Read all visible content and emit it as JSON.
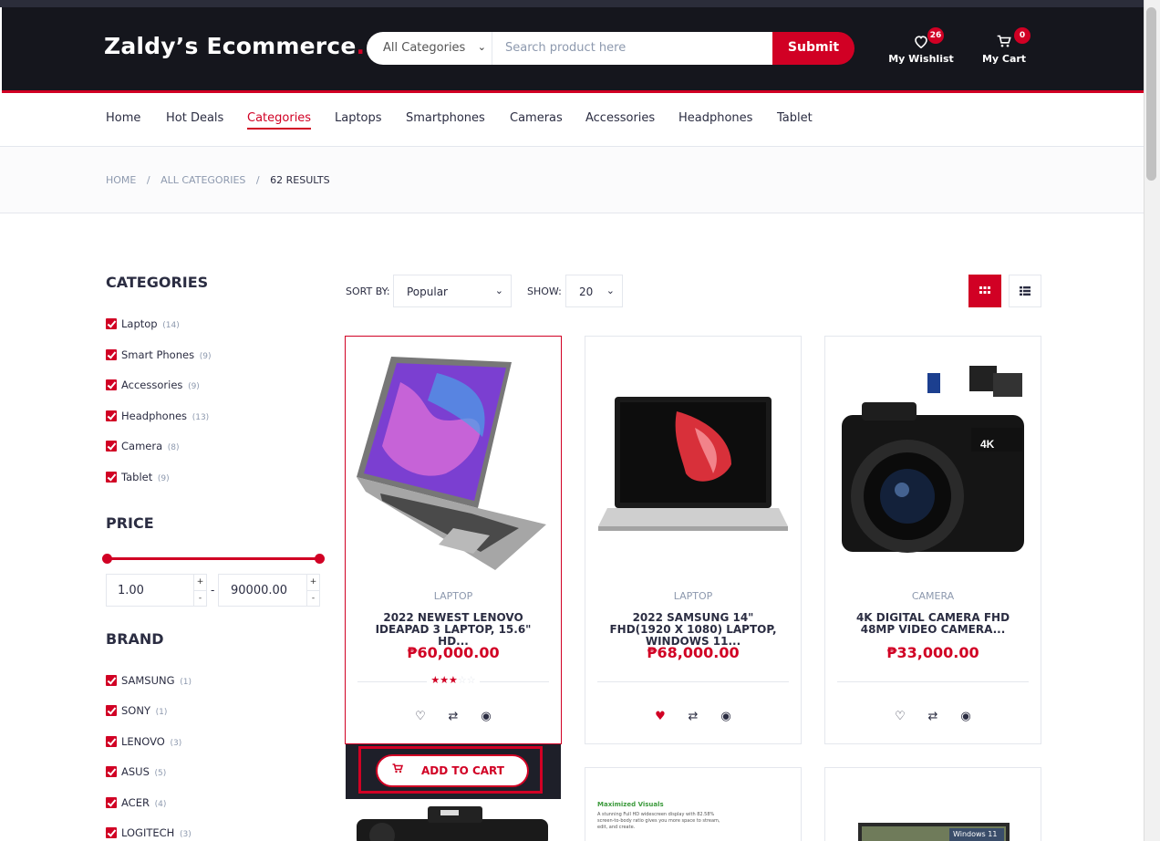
{
  "header": {
    "logo": "Zaldy’s Ecommerce",
    "logo_dot": ".",
    "category_select": "All Categories",
    "search_placeholder": "Search product here",
    "submit": "Submit",
    "wishlist_label": "My Wishlist",
    "wishlist_count": "26",
    "cart_label": "My Cart",
    "cart_count": "0"
  },
  "nav": {
    "items": [
      "Home",
      "Hot Deals",
      "Categories",
      "Laptops",
      "Smartphones",
      "Cameras",
      "Accessories",
      "Headphones",
      "Tablet"
    ],
    "active": "Categories"
  },
  "breadcrumb": {
    "home": "HOME",
    "sep": "/",
    "all": "ALL CATEGORIES",
    "results": "62 RESULTS"
  },
  "sidebar": {
    "categories_title": "CATEGORIES",
    "categories": [
      {
        "label": "Laptop",
        "count": "(14)"
      },
      {
        "label": "Smart Phones",
        "count": "(9)"
      },
      {
        "label": "Accessories",
        "count": "(9)"
      },
      {
        "label": "Headphones",
        "count": "(13)"
      },
      {
        "label": "Camera",
        "count": "(8)"
      },
      {
        "label": "Tablet",
        "count": "(9)"
      }
    ],
    "price_title": "PRICE",
    "price_min": "1.00",
    "price_max": "90000.00",
    "price_dash": "-",
    "plus": "+",
    "minus": "-",
    "brand_title": "BRAND",
    "brands": [
      {
        "label": "SAMSUNG",
        "count": "(1)"
      },
      {
        "label": "SONY",
        "count": "(1)"
      },
      {
        "label": "LENOVO",
        "count": "(3)"
      },
      {
        "label": "ASUS",
        "count": "(5)"
      },
      {
        "label": "ACER",
        "count": "(4)"
      },
      {
        "label": "LOGITECH",
        "count": "(3)"
      }
    ]
  },
  "toolbar": {
    "sort_label": "SORT BY:",
    "sort_value": "Popular",
    "show_label": "SHOW:",
    "show_value": "20"
  },
  "products": [
    {
      "category": "LAPTOP",
      "name": "2022 NEWEST LENOVO IDEAPAD 3 LAPTOP, 15.6\" HD...",
      "price": "₱60,000.00",
      "rating": 3,
      "liked": false
    },
    {
      "category": "LAPTOP",
      "name": "2022 SAMSUNG 14\" FHD(1920 X 1080) LAPTOP, WINDOWS 11...",
      "price": "₱68,000.00",
      "rating": 0,
      "liked": true
    },
    {
      "category": "CAMERA",
      "name": "4K DIGITAL CAMERA FHD 48MP VIDEO CAMERA...",
      "price": "₱33,000.00",
      "rating": 0,
      "liked": false
    }
  ],
  "add_to_cart": "ADD TO CART",
  "promo_card": {
    "title": "Maximized Visuals",
    "text": "A stunning Full HD widescreen display with 82.58% screen-to-body ratio gives you more space to stream, edit, and create."
  },
  "tablet_badge": "Windows 11",
  "camera_badge": "4K",
  "colors": {
    "accent": "#d10024",
    "header_bg": "#15161d",
    "text": "#2b2d42",
    "muted": "#8d99ae"
  }
}
